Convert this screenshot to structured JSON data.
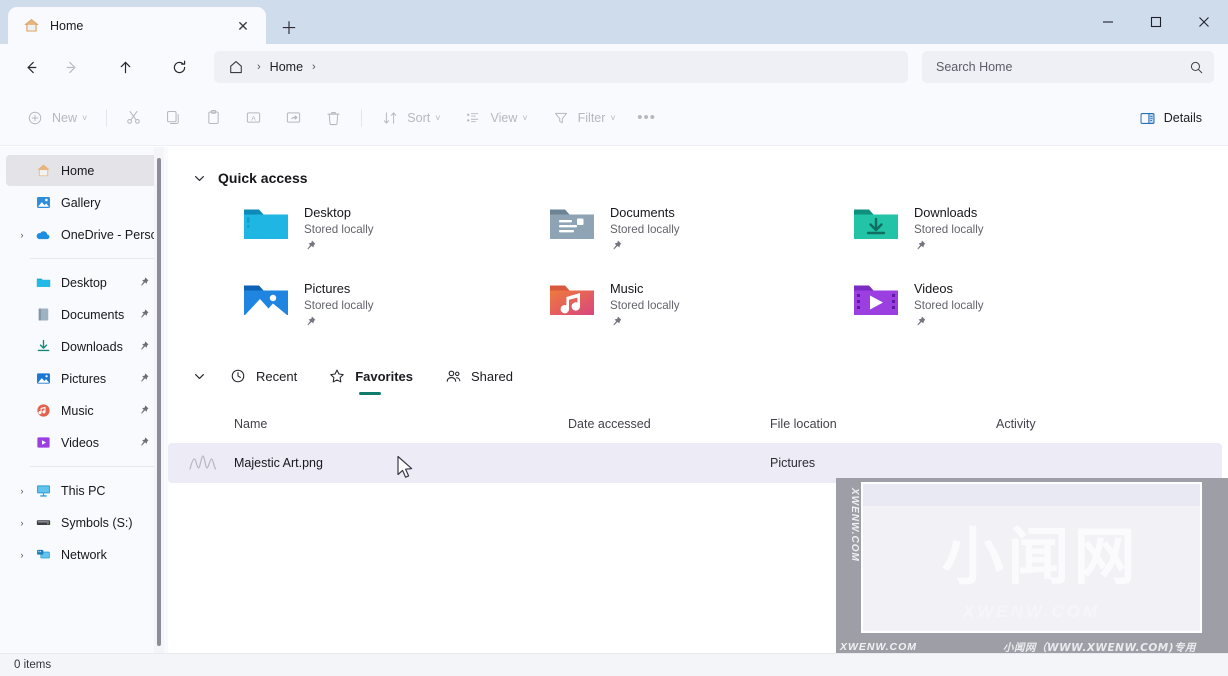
{
  "window": {
    "tab_title": "Home",
    "tab_icon": "home-icon",
    "close_glyph": "✕",
    "newtab_glyph": "＋",
    "minimize_glyph": "─",
    "maximize_glyph": "□",
    "windowclose_glyph": "✕"
  },
  "nav": {
    "back": "back-arrow",
    "forward": "forward-arrow",
    "up": "up-arrow",
    "refresh": "refresh-arrow",
    "breadcrumb_home_icon": "home-icon",
    "breadcrumb_label": "Home",
    "sep": "›"
  },
  "search": {
    "placeholder": "Search Home",
    "value": "",
    "icon": "search-icon"
  },
  "commandbar": {
    "new_label": "New",
    "new_chevron": "˅",
    "cut_icon": "scissors-icon",
    "copy_icon": "copy-icon",
    "paste_icon": "paste-icon",
    "rename_icon": "rename-icon",
    "share_icon": "share-icon",
    "delete_icon": "trash-icon",
    "sort_label": "Sort",
    "sort_chevron": "˅",
    "view_label": "View",
    "view_chevron": "˅",
    "filter_label": "Filter",
    "filter_chevron": "˅",
    "overflow_glyph": "•••",
    "details_label": "Details"
  },
  "sidebar": {
    "items": [
      {
        "label": "Home",
        "icon": "home-icon",
        "selected": true,
        "twisty": false,
        "pinned": false
      },
      {
        "label": "Gallery",
        "icon": "gallery-icon",
        "selected": false,
        "twisty": false,
        "pinned": false
      },
      {
        "label": "OneDrive - Persc",
        "icon": "onedrive-icon",
        "selected": false,
        "twisty": true,
        "pinned": false
      }
    ],
    "pinned_items": [
      {
        "label": "Desktop",
        "icon": "desktop-folder-icon",
        "pinned": true
      },
      {
        "label": "Documents",
        "icon": "documents-folder-icon",
        "pinned": true
      },
      {
        "label": "Downloads",
        "icon": "downloads-icon",
        "pinned": true
      },
      {
        "label": "Pictures",
        "icon": "pictures-folder-icon",
        "pinned": true
      },
      {
        "label": "Music",
        "icon": "music-folder-icon",
        "pinned": true
      },
      {
        "label": "Videos",
        "icon": "videos-folder-icon",
        "pinned": true
      }
    ],
    "drive_items": [
      {
        "label": "This PC",
        "icon": "this-pc-icon",
        "twisty": true
      },
      {
        "label": "Symbols (S:)",
        "icon": "drive-icon",
        "twisty": true
      },
      {
        "label": "Network",
        "icon": "network-icon",
        "twisty": true
      }
    ],
    "pin_glyph": "📌",
    "twisty_glyph": "›"
  },
  "quick_access": {
    "title": "Quick access",
    "chevron": "˅",
    "items": [
      {
        "name": "Desktop",
        "sub": "Stored locally",
        "icon": "desktop-folder-icon",
        "color": "#1aa8d4"
      },
      {
        "name": "Documents",
        "sub": "Stored locally",
        "icon": "documents-folder-icon",
        "color": "#7f97a8"
      },
      {
        "name": "Downloads",
        "sub": "Stored locally",
        "icon": "downloads-folder-icon",
        "color": "#18b59a"
      },
      {
        "name": "Pictures",
        "sub": "Stored locally",
        "icon": "pictures-folder-icon",
        "color": "#1a78d4"
      },
      {
        "name": "Music",
        "sub": "Stored locally",
        "icon": "music-folder-icon",
        "color": "#e0614d"
      },
      {
        "name": "Videos",
        "sub": "Stored locally",
        "icon": "videos-folder-icon",
        "color": "#9b3fe0"
      }
    ],
    "pin_glyph": "📌"
  },
  "file_tabs": {
    "chevron": "˅",
    "tabs": [
      {
        "label": "Recent",
        "icon": "clock-icon",
        "active": false
      },
      {
        "label": "Favorites",
        "icon": "star-icon",
        "active": true
      },
      {
        "label": "Shared",
        "icon": "people-icon",
        "active": false
      }
    ],
    "active_underline_color": "#107c6e"
  },
  "file_list": {
    "columns": [
      "Name",
      "Date accessed",
      "File location",
      "Activity"
    ],
    "rows": [
      {
        "name": "Majestic Art.png",
        "date_accessed": "",
        "file_location": "Pictures",
        "activity": "",
        "icon": "image-thumbnail-icon",
        "selected": true
      }
    ]
  },
  "status": {
    "item_count": "0 items"
  },
  "watermark": {
    "cn_text": "小闻网",
    "domain": "XWENW.COM",
    "side_text": "XWENW.COM",
    "footer_left": "XWENW.COM",
    "footer_right": "小闻网（WWW.XWENW.COM)专用"
  },
  "colors": {
    "titlebar": "#cfdcec",
    "chrome": "#f9fafd",
    "content": "#ffffff",
    "selection": "#edecf6",
    "sidebar_selection": "#e3e3e8",
    "accent_teal": "#107c6e"
  }
}
